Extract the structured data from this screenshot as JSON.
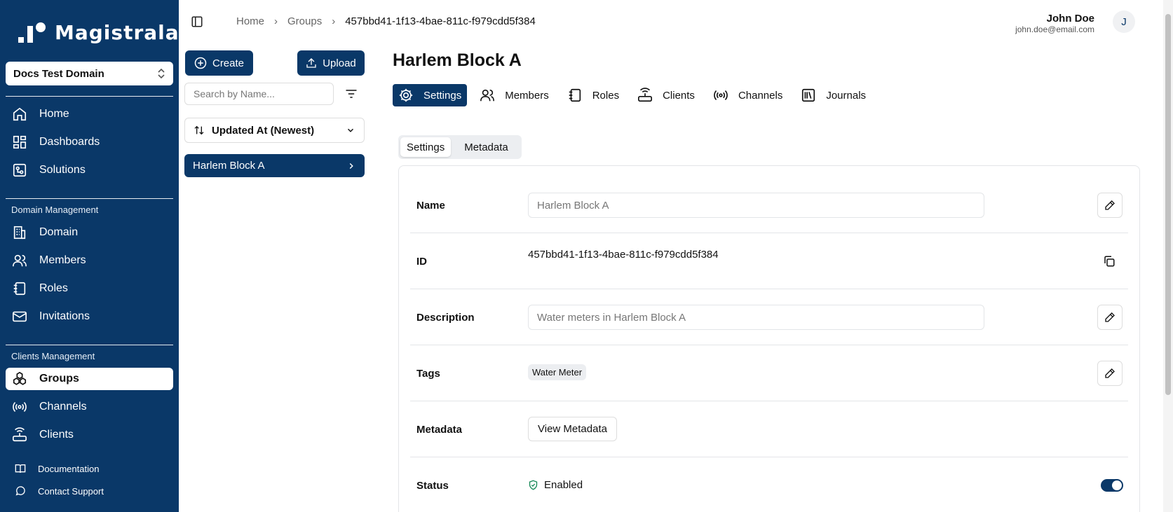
{
  "app": {
    "brand": "Magistrala",
    "accent": "#0a3868"
  },
  "sidebar": {
    "domain": "Docs Test Domain",
    "main": [
      {
        "label": "Home",
        "icon": "home-icon"
      },
      {
        "label": "Dashboards",
        "icon": "dashboard-icon"
      },
      {
        "label": "Solutions",
        "icon": "solutions-icon"
      }
    ],
    "domain_section": "Domain Management",
    "domain_items": [
      {
        "label": "Domain",
        "icon": "building-icon"
      },
      {
        "label": "Members",
        "icon": "users-icon"
      },
      {
        "label": "Roles",
        "icon": "roles-icon"
      },
      {
        "label": "Invitations",
        "icon": "mail-icon"
      }
    ],
    "clients_section": "Clients Management",
    "clients_items": [
      {
        "label": "Groups",
        "icon": "groups-icon",
        "active": true
      },
      {
        "label": "Channels",
        "icon": "channels-icon"
      },
      {
        "label": "Clients",
        "icon": "router-icon"
      }
    ],
    "footer": [
      {
        "label": "Documentation",
        "icon": "book-icon"
      },
      {
        "label": "Contact Support",
        "icon": "chat-icon"
      }
    ]
  },
  "breadcrumb": [
    "Home",
    "Groups",
    "457bbd41-1f13-4bae-811c-f979cdd5f384"
  ],
  "user": {
    "name": "John Doe",
    "email": "john.doe@email.com",
    "initial": "J"
  },
  "list_panel": {
    "create_label": "Create",
    "upload_label": "Upload",
    "search_placeholder": "Search by Name...",
    "sort_label": "Updated At (Newest)",
    "items": [
      "Harlem Block A"
    ]
  },
  "page": {
    "title": "Harlem Block A",
    "tabs": [
      "Settings",
      "Members",
      "Roles",
      "Clients",
      "Channels",
      "Journals"
    ],
    "subtabs": [
      "Settings",
      "Metadata"
    ],
    "fields": {
      "name_label": "Name",
      "name_value": "Harlem Block A",
      "id_label": "ID",
      "id_value": "457bbd41-1f13-4bae-811c-f979cdd5f384",
      "description_label": "Description",
      "description_value": "Water meters in Harlem Block A",
      "tags_label": "Tags",
      "tag": "Water Meter",
      "metadata_label": "Metadata",
      "metadata_button": "View Metadata",
      "status_label": "Status",
      "status_value": "Enabled",
      "status_on": true
    }
  }
}
